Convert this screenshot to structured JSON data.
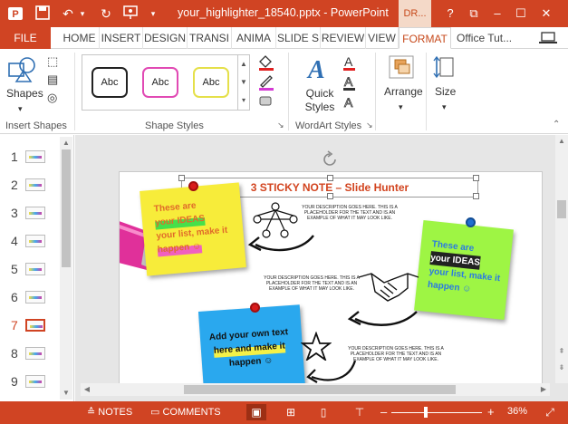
{
  "titlebar": {
    "title": "your_highlighter_18540.pptx - PowerPoint",
    "context_tab": "DR...",
    "help": "?",
    "restore": "⧉",
    "minimize": "–",
    "maximize": "☐",
    "close": "✕"
  },
  "tabs": {
    "file": "FILE",
    "items": [
      "HOME",
      "INSERT",
      "DESIGN",
      "TRANSI",
      "ANIMA",
      "SLIDE S",
      "REVIEW",
      "VIEW",
      "FORMAT"
    ],
    "active": "FORMAT",
    "user": "Office Tut..."
  },
  "ribbon": {
    "insert_shapes": {
      "shapes_label": "Shapes",
      "group_label": "Insert Shapes"
    },
    "shape_styles": {
      "samples": [
        "Abc",
        "Abc",
        "Abc"
      ],
      "group_label": "Shape Styles"
    },
    "wordart": {
      "quick_styles_label": "Quick Styles",
      "group_label": "WordArt Styles"
    },
    "arrange_label": "Arrange",
    "size_label": "Size"
  },
  "thumbnails": {
    "numbers": [
      "1",
      "2",
      "3",
      "4",
      "5",
      "6",
      "7",
      "8",
      "9"
    ],
    "active_index": 7
  },
  "slide": {
    "title": "3 STICKY NOTE – Slide Hunter",
    "note1": [
      "These are",
      "your IDEAS",
      "your list, make it",
      "happen ☺"
    ],
    "note2": [
      "These are",
      "your IDEAS",
      "your list, make it",
      "happen ☺"
    ],
    "note3": [
      "Add your own text",
      "here and make it",
      "happen ☺"
    ],
    "desc1": "YOUR DESCRIPTION GOES HERE. THIS IS A PLACEHOLDER FOR THE TEXT AND IS AN EXAMPLE OF WHAT IT MAY LOOK LIKE.",
    "desc2": "YOUR DESCRIPTION GOES HERE. THIS IS A PLACEHOLDER FOR THE TEXT AND IS AN EXAMPLE OF WHAT IT MAY LOOK LIKE.",
    "desc3": "YOUR DESCRIPTION GOES HERE. THIS IS A PLACEHOLDER FOR THE TEXT AND IS AN EXAMPLE OF WHAT IT MAY LOOK LIKE."
  },
  "statusbar": {
    "notes": "NOTES",
    "comments": "COMMENTS",
    "zoom_out": "–",
    "zoom_in": "+",
    "zoom": "36%"
  },
  "colors": {
    "accent": "#d04423",
    "yellow_note": "#f7ec3a",
    "green_note": "#9ef544",
    "blue_note": "#2aa8ee"
  }
}
